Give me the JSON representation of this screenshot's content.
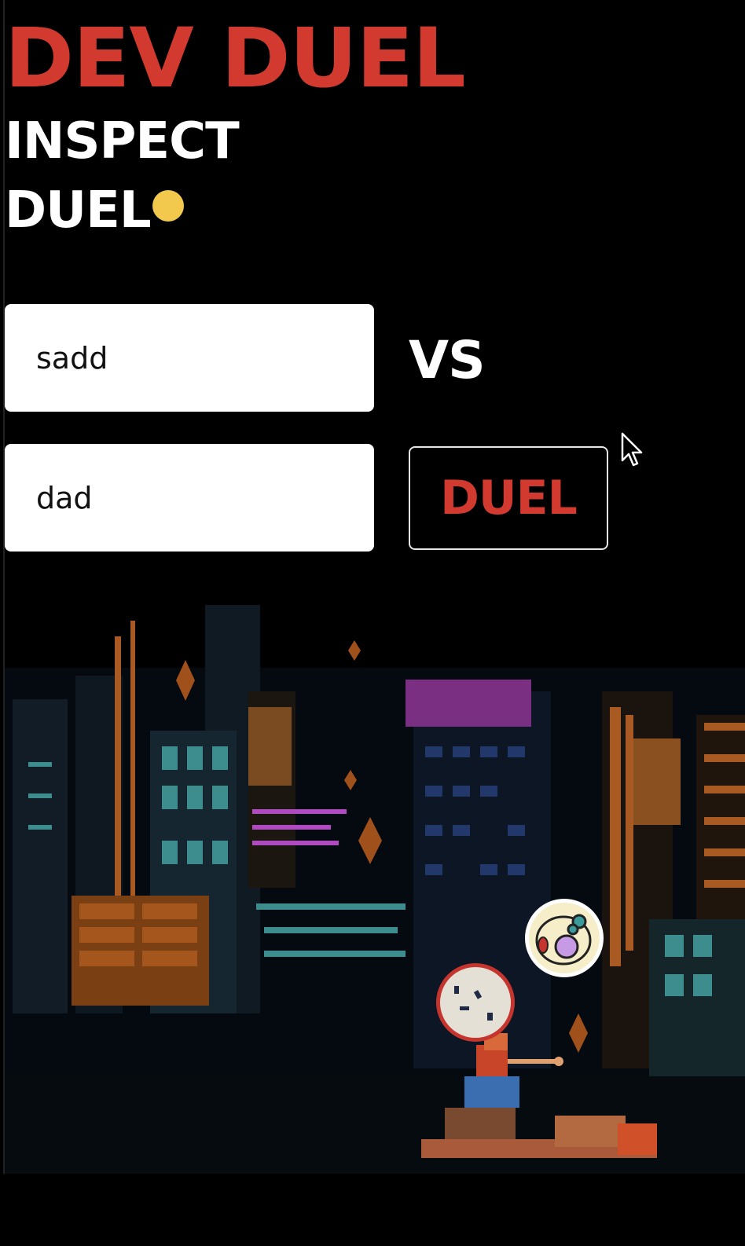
{
  "header": {
    "title": "DEV DUEL",
    "nav": {
      "inspect": "INSPECT",
      "duel": "DUEL"
    }
  },
  "form": {
    "user1_value": "sadd",
    "user2_value": "dad",
    "vs_label": "VS",
    "duel_button_label": "DUEL"
  },
  "colors": {
    "accent_red": "#d23a2f",
    "active_dot": "#f2c94c",
    "background": "#000000"
  },
  "icons": [
    "status-dot-icon",
    "mouse-pointer-icon"
  ]
}
